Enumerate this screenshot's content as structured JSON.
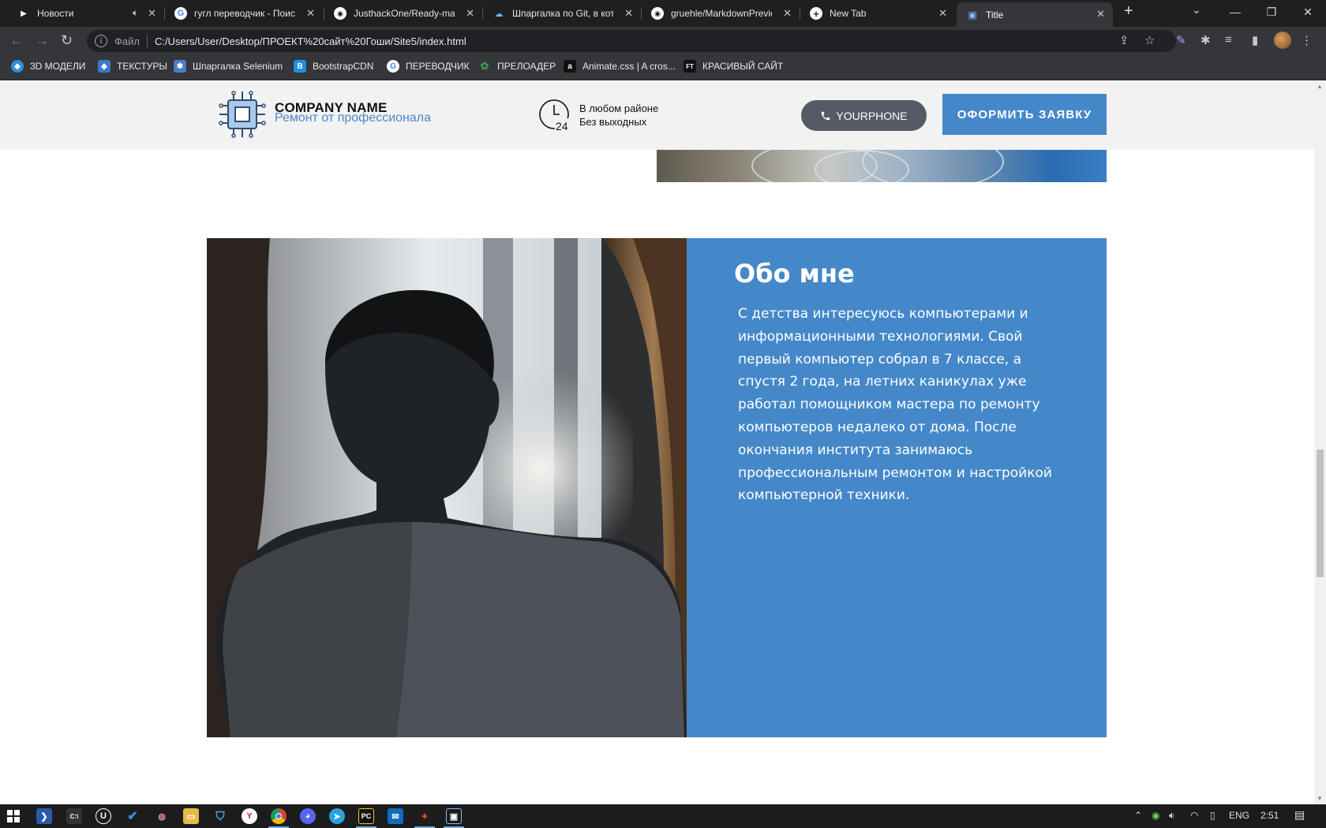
{
  "browser": {
    "tabs": [
      {
        "title": "Новости",
        "favicon": "play-icon"
      },
      {
        "title": "гугл переводчик - Поиск в Google",
        "favicon": "google-icon"
      },
      {
        "title": "JusthackOne/Ready-made",
        "favicon": "github-icon"
      },
      {
        "title": "Шпаргалка по Git, в которой",
        "favicon": "git-cheatsheet-icon"
      },
      {
        "title": "gruehle/MarkdownPreview",
        "favicon": "github-icon"
      },
      {
        "title": "New Tab",
        "favicon": "new-tab-icon"
      },
      {
        "title": "Title",
        "favicon": "site-icon",
        "active": true
      }
    ],
    "address": {
      "scheme_label": "Файл",
      "url": "C:/Users/User/Desktop/ПРОЕКТ%20сайт%20Гоши/Site5/index.html"
    },
    "bookmarks": [
      {
        "label": "3D МОДЕЛИ",
        "icon": "3d-models-icon",
        "color": "#2f8fd8"
      },
      {
        "label": "ТЕКСТУРЫ",
        "icon": "textures-icon",
        "color": "#3b78c8"
      },
      {
        "label": "Шпаргалка Selenium",
        "icon": "selenium-icon",
        "color": "#4a7dc4"
      },
      {
        "label": "BootstrapCDN",
        "icon": "bootstrap-icon",
        "color": "#1f8fe0"
      },
      {
        "label": "ПЕРЕВОДЧИК",
        "icon": "google-icon",
        "color": "#ffffff"
      },
      {
        "label": "ПРЕЛОАДЕР",
        "icon": "preloader-icon",
        "color": "#3a9b48"
      },
      {
        "label": "Animate.css | A cros...",
        "icon": "animate-icon",
        "color": "#111111"
      },
      {
        "label": "КРАСИВЫЙ САЙТ",
        "icon": "ft-icon",
        "color": "#111111"
      }
    ]
  },
  "site": {
    "header": {
      "company_name": "COMPANY NAME",
      "company_sub": "Ремонт от профессионала",
      "clock_number": "24",
      "hours_line1": "В любом районе",
      "hours_line2": "Без выходных",
      "phone_label": "YOURPHONE",
      "order_label": "ОФОРМИТЬ ЗАЯВКУ"
    },
    "about": {
      "title": "Обо мне",
      "text": "С детства интересуюсь компьютерами и информационными технологиями. Свой первый компьютер собрал в 7 классе, а спустя 2 года, на летних каникулах уже работал помощником мастера по ремонту компьютеров недалеко от дома. После окончания института занимаюсь профессиональным ремонтом и настройкой компьютерной техники."
    },
    "accent_color": "#4588c9"
  },
  "taskbar": {
    "apps": [
      "windows-start-icon",
      "powershell-icon",
      "cmd-icon",
      "unreal-icon",
      "todo-icon",
      "game-icon",
      "file-explorer-icon",
      "shield-icon",
      "yandex-icon",
      "chrome-icon",
      "discord-icon",
      "telegram-icon",
      "pycharm-icon",
      "outlook-icon",
      "figma-icon",
      "app-icon"
    ],
    "language": "ENG",
    "time": "2:51"
  }
}
